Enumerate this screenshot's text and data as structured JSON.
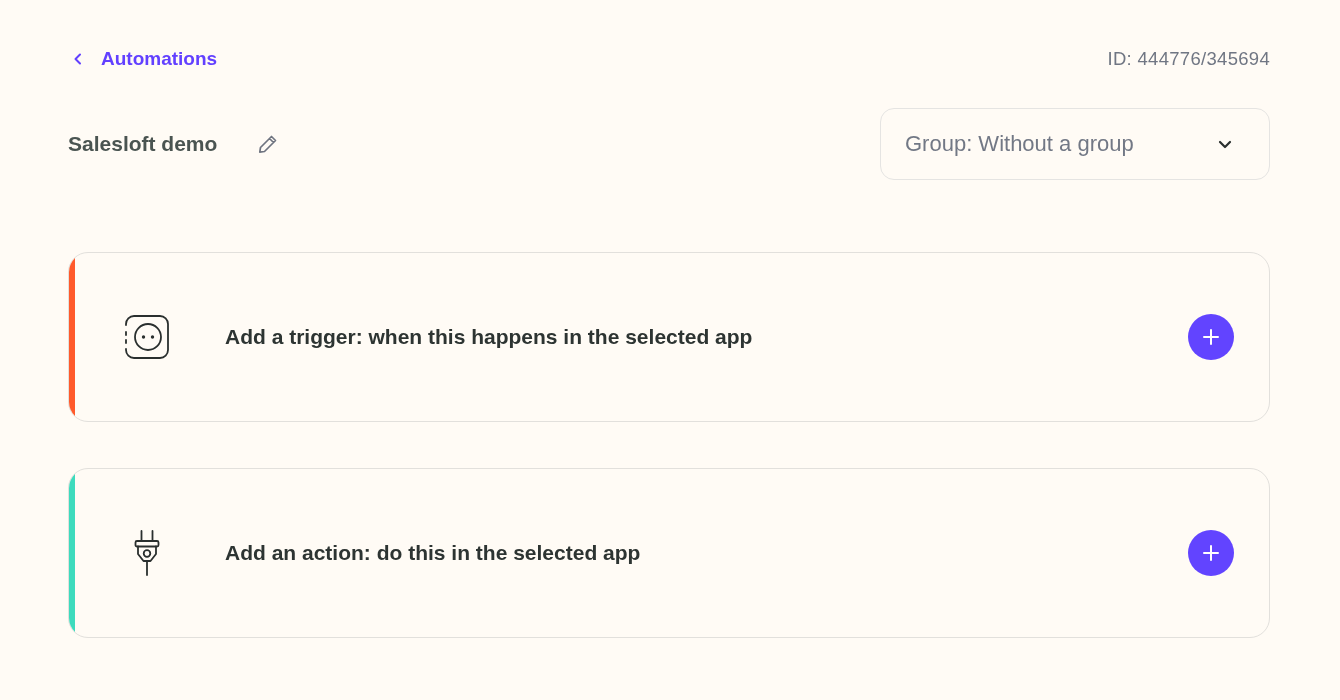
{
  "header": {
    "back_link": "Automations",
    "id_text": "ID: 444776/345694"
  },
  "automation": {
    "title": "Salesloft demo"
  },
  "group_select": {
    "value": "Group: Without a group"
  },
  "steps": [
    {
      "kind": "trigger",
      "label": "Add a trigger: when this happens in the selected app",
      "color": "#ff5a2b"
    },
    {
      "kind": "action",
      "label": "Add an action: do this in the selected app",
      "color": "#3ddbbd"
    }
  ]
}
